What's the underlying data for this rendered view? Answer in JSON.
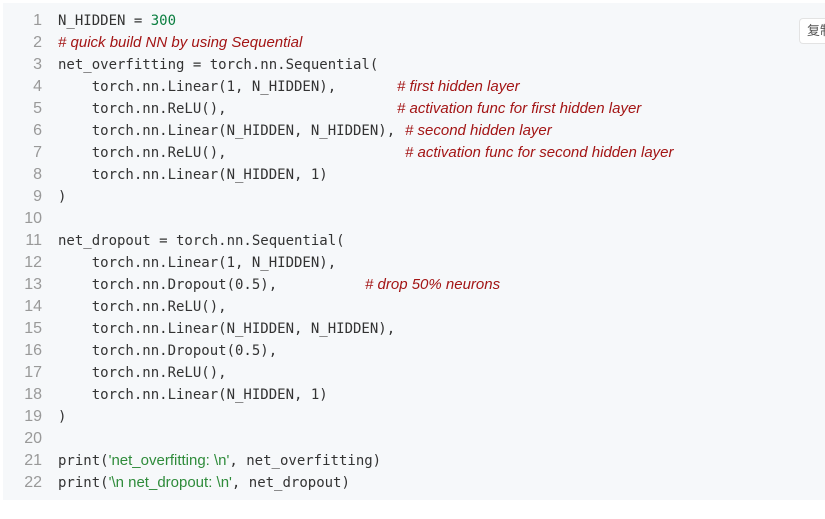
{
  "copy_button": {
    "label": "复制"
  },
  "lines": [
    {
      "n": "1",
      "code_a": "N_HIDDEN = ",
      "num": "300",
      "code_b": "",
      "comment": ""
    },
    {
      "n": "2",
      "code_a": "",
      "num": "",
      "code_b": "",
      "comment": "# quick build NN by using Sequential"
    },
    {
      "n": "3",
      "code_a": "net_overfitting = torch.nn.Sequential(",
      "num": "",
      "code_b": "",
      "comment": ""
    },
    {
      "n": "4",
      "code_a": "    torch.nn.Linear(1, N_HIDDEN),",
      "num": "",
      "code_b": "",
      "comment": "# first hidden layer"
    },
    {
      "n": "5",
      "code_a": "    torch.nn.ReLU(),",
      "num": "",
      "code_b": "",
      "comment": "# activation func for first hidden layer"
    },
    {
      "n": "6",
      "code_a": "    torch.nn.Linear(N_HIDDEN, N_HIDDEN),",
      "num": "",
      "code_b": "",
      "comment": "# second hidden layer"
    },
    {
      "n": "7",
      "code_a": "    torch.nn.ReLU(),",
      "num": "",
      "code_b": "",
      "comment": "# activation func for second hidden layer"
    },
    {
      "n": "8",
      "code_a": "    torch.nn.Linear(N_HIDDEN, 1)",
      "num": "",
      "code_b": "",
      "comment": ""
    },
    {
      "n": "9",
      "code_a": ")",
      "num": "",
      "code_b": "",
      "comment": ""
    },
    {
      "n": "10",
      "code_a": "",
      "num": "",
      "code_b": "",
      "comment": ""
    },
    {
      "n": "11",
      "code_a": "net_dropout = torch.nn.Sequential(",
      "num": "",
      "code_b": "",
      "comment": ""
    },
    {
      "n": "12",
      "code_a": "    torch.nn.Linear(1, N_HIDDEN),",
      "num": "",
      "code_b": "",
      "comment": ""
    },
    {
      "n": "13",
      "code_a": "    torch.nn.Dropout(0.5),",
      "num": "",
      "code_b": "",
      "comment": "# drop 50% neurons"
    },
    {
      "n": "14",
      "code_a": "    torch.nn.ReLU(),",
      "num": "",
      "code_b": "",
      "comment": ""
    },
    {
      "n": "15",
      "code_a": "    torch.nn.Linear(N_HIDDEN, N_HIDDEN),",
      "num": "",
      "code_b": "",
      "comment": ""
    },
    {
      "n": "16",
      "code_a": "    torch.nn.Dropout(0.5),",
      "num": "",
      "code_b": "",
      "comment": ""
    },
    {
      "n": "17",
      "code_a": "    torch.nn.ReLU(),",
      "num": "",
      "code_b": "",
      "comment": ""
    },
    {
      "n": "18",
      "code_a": "    torch.nn.Linear(N_HIDDEN, 1)",
      "num": "",
      "code_b": "",
      "comment": ""
    },
    {
      "n": "19",
      "code_a": ")",
      "num": "",
      "code_b": "",
      "comment": ""
    },
    {
      "n": "20",
      "code_a": "",
      "num": "",
      "code_b": "",
      "comment": ""
    },
    {
      "n": "21",
      "code_a": "print(",
      "str": "'net_overfitting: \\n'",
      "code_b": ", net_overfitting)",
      "comment": ""
    },
    {
      "n": "22",
      "code_a": "print(",
      "str": "'\\n net_dropout: \\n'",
      "code_b": ", net_dropout)",
      "comment": ""
    }
  ]
}
